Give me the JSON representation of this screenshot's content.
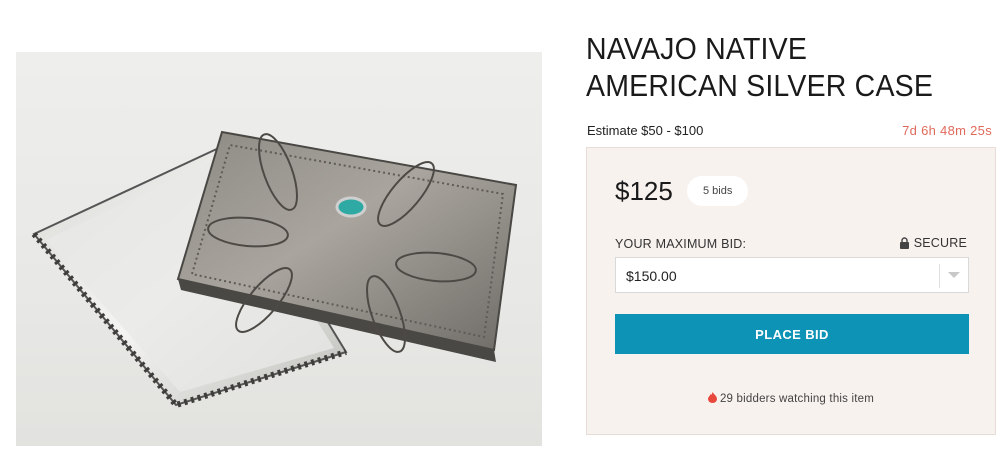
{
  "product": {
    "title": "NAVAJO NATIVE AMERICAN SILVER CASE",
    "estimate": "Estimate $50 - $100",
    "time_left": "7d 6h 48m 25s",
    "image_icon": "silver-case-photo"
  },
  "bidding": {
    "current_price": "$125",
    "bid_count": "5 bids",
    "max_bid_label": "YOUR MAXIMUM BID:",
    "secure_label": "SECURE",
    "selected_bid": "$150.00",
    "place_bid_label": "PLACE BID",
    "watchers_text": "29 bidders watching this item"
  },
  "colors": {
    "accent": "#0c93b6",
    "timer": "#e06a5c",
    "panel_bg": "#f8f2ef",
    "flame": "#e8473b"
  }
}
